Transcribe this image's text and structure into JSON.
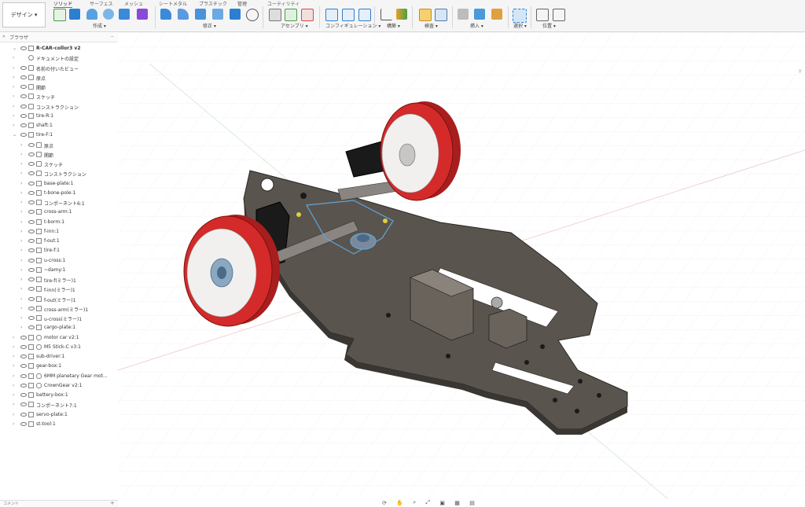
{
  "workspace": {
    "label": "デザイン ▾"
  },
  "tabs": [
    {
      "label": "ソリッド",
      "active": true
    },
    {
      "label": "サーフェス",
      "active": false
    },
    {
      "label": "メッシュ",
      "active": false
    },
    {
      "label": "シートメタル",
      "active": false
    },
    {
      "label": "プラスチック",
      "active": false
    },
    {
      "label": "管理",
      "active": false
    },
    {
      "label": "ユーティリティ",
      "active": false
    }
  ],
  "toolbar_groups": [
    {
      "label": "作成 ▾"
    },
    {
      "label": "修正 ▾"
    },
    {
      "label": "アセンブリ ▾"
    },
    {
      "label": "コンフィギュレーション ▾"
    },
    {
      "label": "構築 ▾"
    },
    {
      "label": "検査 ▾"
    },
    {
      "label": "挿入 ▾"
    },
    {
      "label": "選択 ▾"
    },
    {
      "label": "位置 ▾"
    }
  ],
  "browser": {
    "title": "ブラウザ",
    "items": [
      {
        "label": "R-CAR-collor3 v2",
        "icon": "document-icon"
      },
      {
        "label": "ドキュメントの設定",
        "icon": "gear-icon"
      },
      {
        "label": "名前の付いたビュー",
        "icon": "folder-icon"
      },
      {
        "label": "原点",
        "icon": "folder-icon"
      },
      {
        "label": "関節",
        "icon": "folder-icon"
      },
      {
        "label": "スケッチ",
        "icon": "folder-icon"
      },
      {
        "label": "コンストラクション",
        "icon": "folder-icon"
      },
      {
        "label": "tire-R:1",
        "icon": "component-icon"
      },
      {
        "label": "shaft:1",
        "icon": "component-icon"
      },
      {
        "label": "tire-F:1",
        "icon": "component-icon"
      },
      {
        "label": "原点",
        "icon": "folder-icon"
      },
      {
        "label": "関節",
        "icon": "folder-icon"
      },
      {
        "label": "スケッチ",
        "icon": "folder-icon"
      },
      {
        "label": "コンストラクション",
        "icon": "folder-icon"
      },
      {
        "label": "base-plate:1",
        "icon": "component-icon"
      },
      {
        "label": "t-bone-pole:1",
        "icon": "component-icon"
      },
      {
        "label": "コンポーネント6:1",
        "icon": "component-icon"
      },
      {
        "label": "cross-arm:1",
        "icon": "component-icon"
      },
      {
        "label": "t-borm:1",
        "icon": "component-icon"
      },
      {
        "label": "f-inn:1",
        "icon": "component-icon"
      },
      {
        "label": "f-out:1",
        "icon": "component-icon"
      },
      {
        "label": "tire-f:1",
        "icon": "component-icon"
      },
      {
        "label": "u-cross:1",
        "icon": "component-icon"
      },
      {
        "label": "~damy:1",
        "icon": "component-icon"
      },
      {
        "label": "tire-f(ミラー)1",
        "icon": "component-icon"
      },
      {
        "label": "f-inn(ミラー)1",
        "icon": "component-icon"
      },
      {
        "label": "f-out(ミラー)1",
        "icon": "component-icon"
      },
      {
        "label": "cross-arm(ミラー)1",
        "icon": "component-icon"
      },
      {
        "label": "u-cross(ミラー)1",
        "icon": "component-icon"
      },
      {
        "label": "cargo-plate:1",
        "icon": "component-icon"
      },
      {
        "label": "motor car v2:1",
        "icon": "link-icon"
      },
      {
        "label": "M5 Stick-C v3:1",
        "icon": "link-icon"
      },
      {
        "label": "sub-driver:1",
        "icon": "component-icon"
      },
      {
        "label": "gear-box:1",
        "icon": "component-icon"
      },
      {
        "label": "6MM planetary Gear mot...",
        "icon": "link-icon"
      },
      {
        "label": "CrownGear v2:1",
        "icon": "link-icon"
      },
      {
        "label": "battery-box:1",
        "icon": "component-icon"
      },
      {
        "label": "コンポーネント7:1",
        "icon": "component-icon"
      },
      {
        "label": "servo-plate:1",
        "icon": "component-icon"
      },
      {
        "label": "st-tool:1",
        "icon": "component-icon"
      }
    ]
  },
  "comments": {
    "label": "コメント"
  },
  "colors": {
    "accent": "#2a7fd1",
    "tire": "#d42a2a",
    "plate": "#5a544e",
    "arm": "#1a1a1a",
    "highlight": "#5fa6d8"
  }
}
